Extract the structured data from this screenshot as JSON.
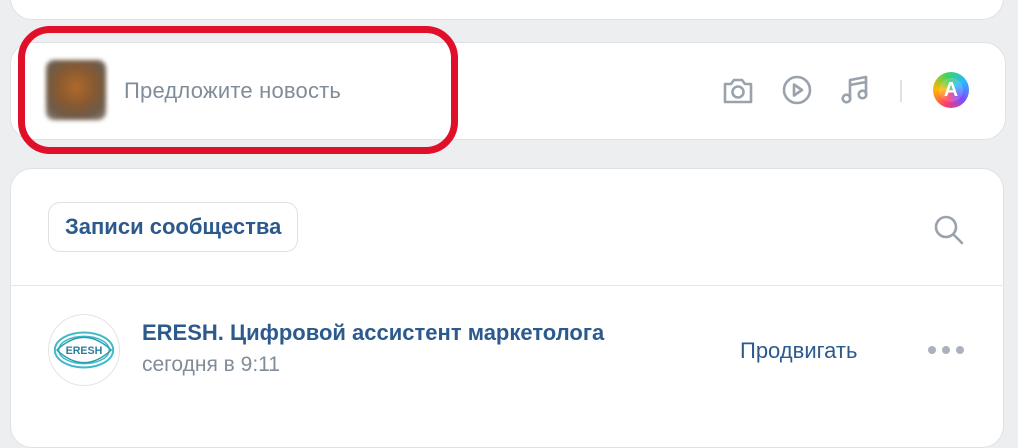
{
  "composer": {
    "placeholder": "Предложите новость",
    "icons": [
      "camera-icon",
      "play-icon",
      "music-note-icon"
    ],
    "assistant_badge": "A"
  },
  "feed": {
    "tab_label": "Записи сообщества",
    "post": {
      "author": "ERESH. Цифровой ассистент маркетолога",
      "time": "сегодня в 9:11",
      "promote_label": "Продвигать",
      "logo_text": "ERESH"
    }
  },
  "colors": {
    "accent_text": "#2c5a8c",
    "secondary_text": "#818c99",
    "highlight": "#e0102a",
    "background": "#edeef0"
  }
}
